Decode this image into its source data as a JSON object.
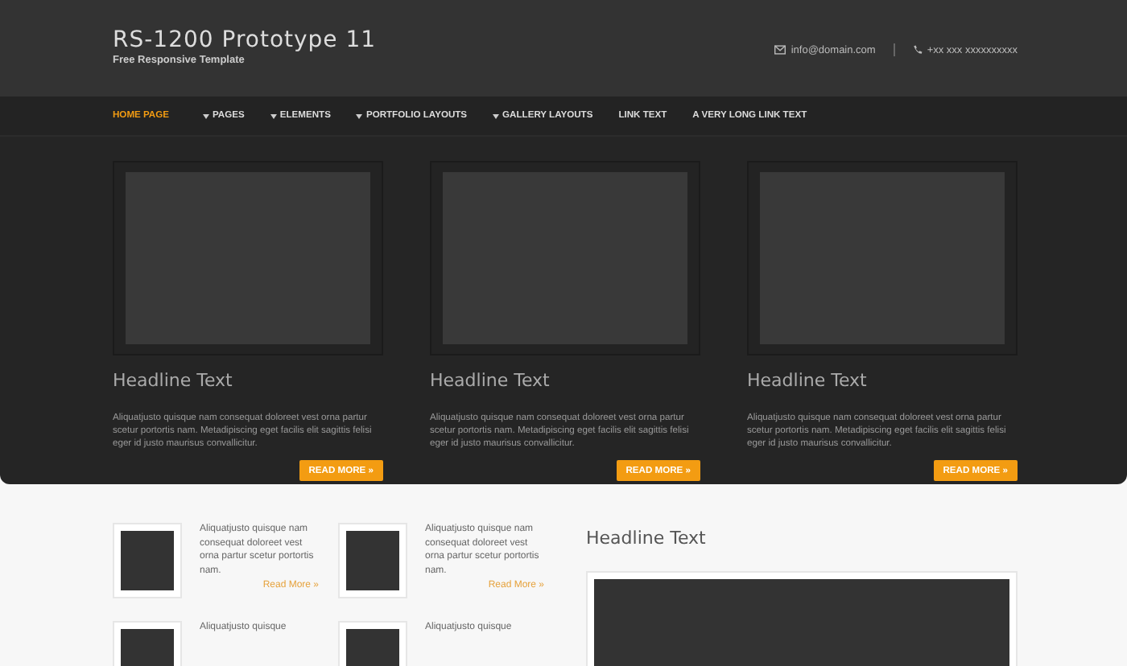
{
  "header": {
    "title": "RS-1200 Prototype 11",
    "subtitle": "Free Responsive Template",
    "email": "info@domain.com",
    "phone": "+xx xxx xxxxxxxxxx"
  },
  "nav": [
    {
      "label": "HOME PAGE",
      "selected": true,
      "dropdown": false
    },
    {
      "label": "PAGES",
      "selected": false,
      "dropdown": true
    },
    {
      "label": "ELEMENTS",
      "selected": false,
      "dropdown": true
    },
    {
      "label": "PORTFOLIO LAYOUTS",
      "selected": false,
      "dropdown": true
    },
    {
      "label": "GALLERY LAYOUTS",
      "selected": false,
      "dropdown": true
    },
    {
      "label": "LINK TEXT",
      "selected": false,
      "dropdown": false
    },
    {
      "label": "A VERY LONG LINK TEXT",
      "selected": false,
      "dropdown": false
    }
  ],
  "features": [
    {
      "headline": "Headline Text",
      "text": "Aliquatjusto quisque nam consequat doloreet vest orna partur scetur portortis nam. Metadipiscing eget facilis elit sagittis felisi eger id justo maurisus convallicitur.",
      "button": "READ MORE »"
    },
    {
      "headline": "Headline Text",
      "text": "Aliquatjusto quisque nam consequat doloreet vest orna partur scetur portortis nam. Metadipiscing eget facilis elit sagittis felisi eger id justo maurisus convallicitur.",
      "button": "READ MORE »"
    },
    {
      "headline": "Headline Text",
      "text": "Aliquatjusto quisque nam consequat doloreet vest orna partur scetur portortis nam. Metadipiscing eget facilis elit sagittis felisi eger id justo maurisus convallicitur.",
      "button": "READ MORE »"
    }
  ],
  "posts": [
    {
      "text": "Aliquatjusto quisque nam consequat doloreet vest orna partur scetur portortis nam.",
      "link": "Read More »"
    },
    {
      "text": "Aliquatjusto quisque nam consequat doloreet vest orna partur scetur portortis nam.",
      "link": "Read More »"
    },
    {
      "text": "Aliquatjusto quisque"
    },
    {
      "text": "Aliquatjusto quisque"
    }
  ],
  "side": {
    "headline": "Headline Text"
  }
}
